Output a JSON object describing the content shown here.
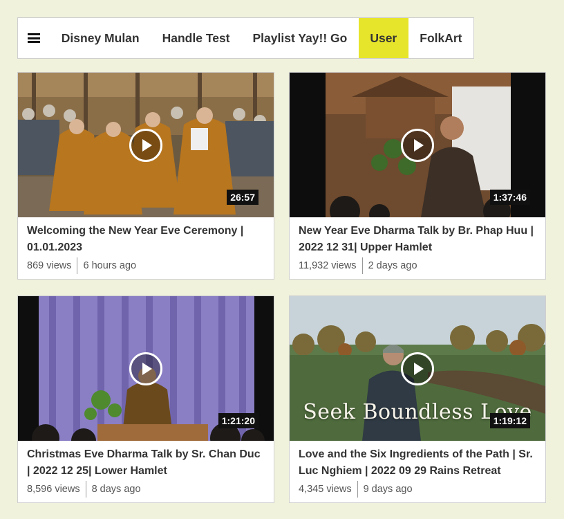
{
  "nav": {
    "menu_icon": "hamburger-icon",
    "tabs": [
      {
        "label": "Disney Mulan",
        "active": false
      },
      {
        "label": "Handle Test",
        "active": false
      },
      {
        "label": "Playlist Yay!! Go",
        "active": false
      },
      {
        "label": "User",
        "active": true
      },
      {
        "label": "FolkArt",
        "active": false
      }
    ],
    "active_color": "#e7e52b"
  },
  "videos": [
    {
      "title": "Welcoming the New Year Eve Ceremony | 01.01.2023",
      "duration": "26:57",
      "views": "869 views",
      "age": "6 hours ago"
    },
    {
      "title": "New Year Eve Dharma Talk by Br. Phap Huu | 2022 12 31| Upper Hamlet",
      "duration": "1:37:46",
      "views": "11,932 views",
      "age": "2 days ago"
    },
    {
      "title": "Christmas Eve Dharma Talk by Sr. Chan Duc | 2022 12 25| Lower Hamlet",
      "duration": "1:21:20",
      "views": "8,596 views",
      "age": "8 days ago"
    },
    {
      "title": "Love and the Six Ingredients of the Path | Sr. Luc Nghiem | 2022 09 29 Rains Retreat",
      "duration": "1:19:12",
      "views": "4,345 views",
      "age": "9 days ago",
      "thumbnail_text": "Seek Boundless Love"
    }
  ],
  "colors": {
    "page_background": "#f0f2dc",
    "duration_badge": "#111111"
  }
}
